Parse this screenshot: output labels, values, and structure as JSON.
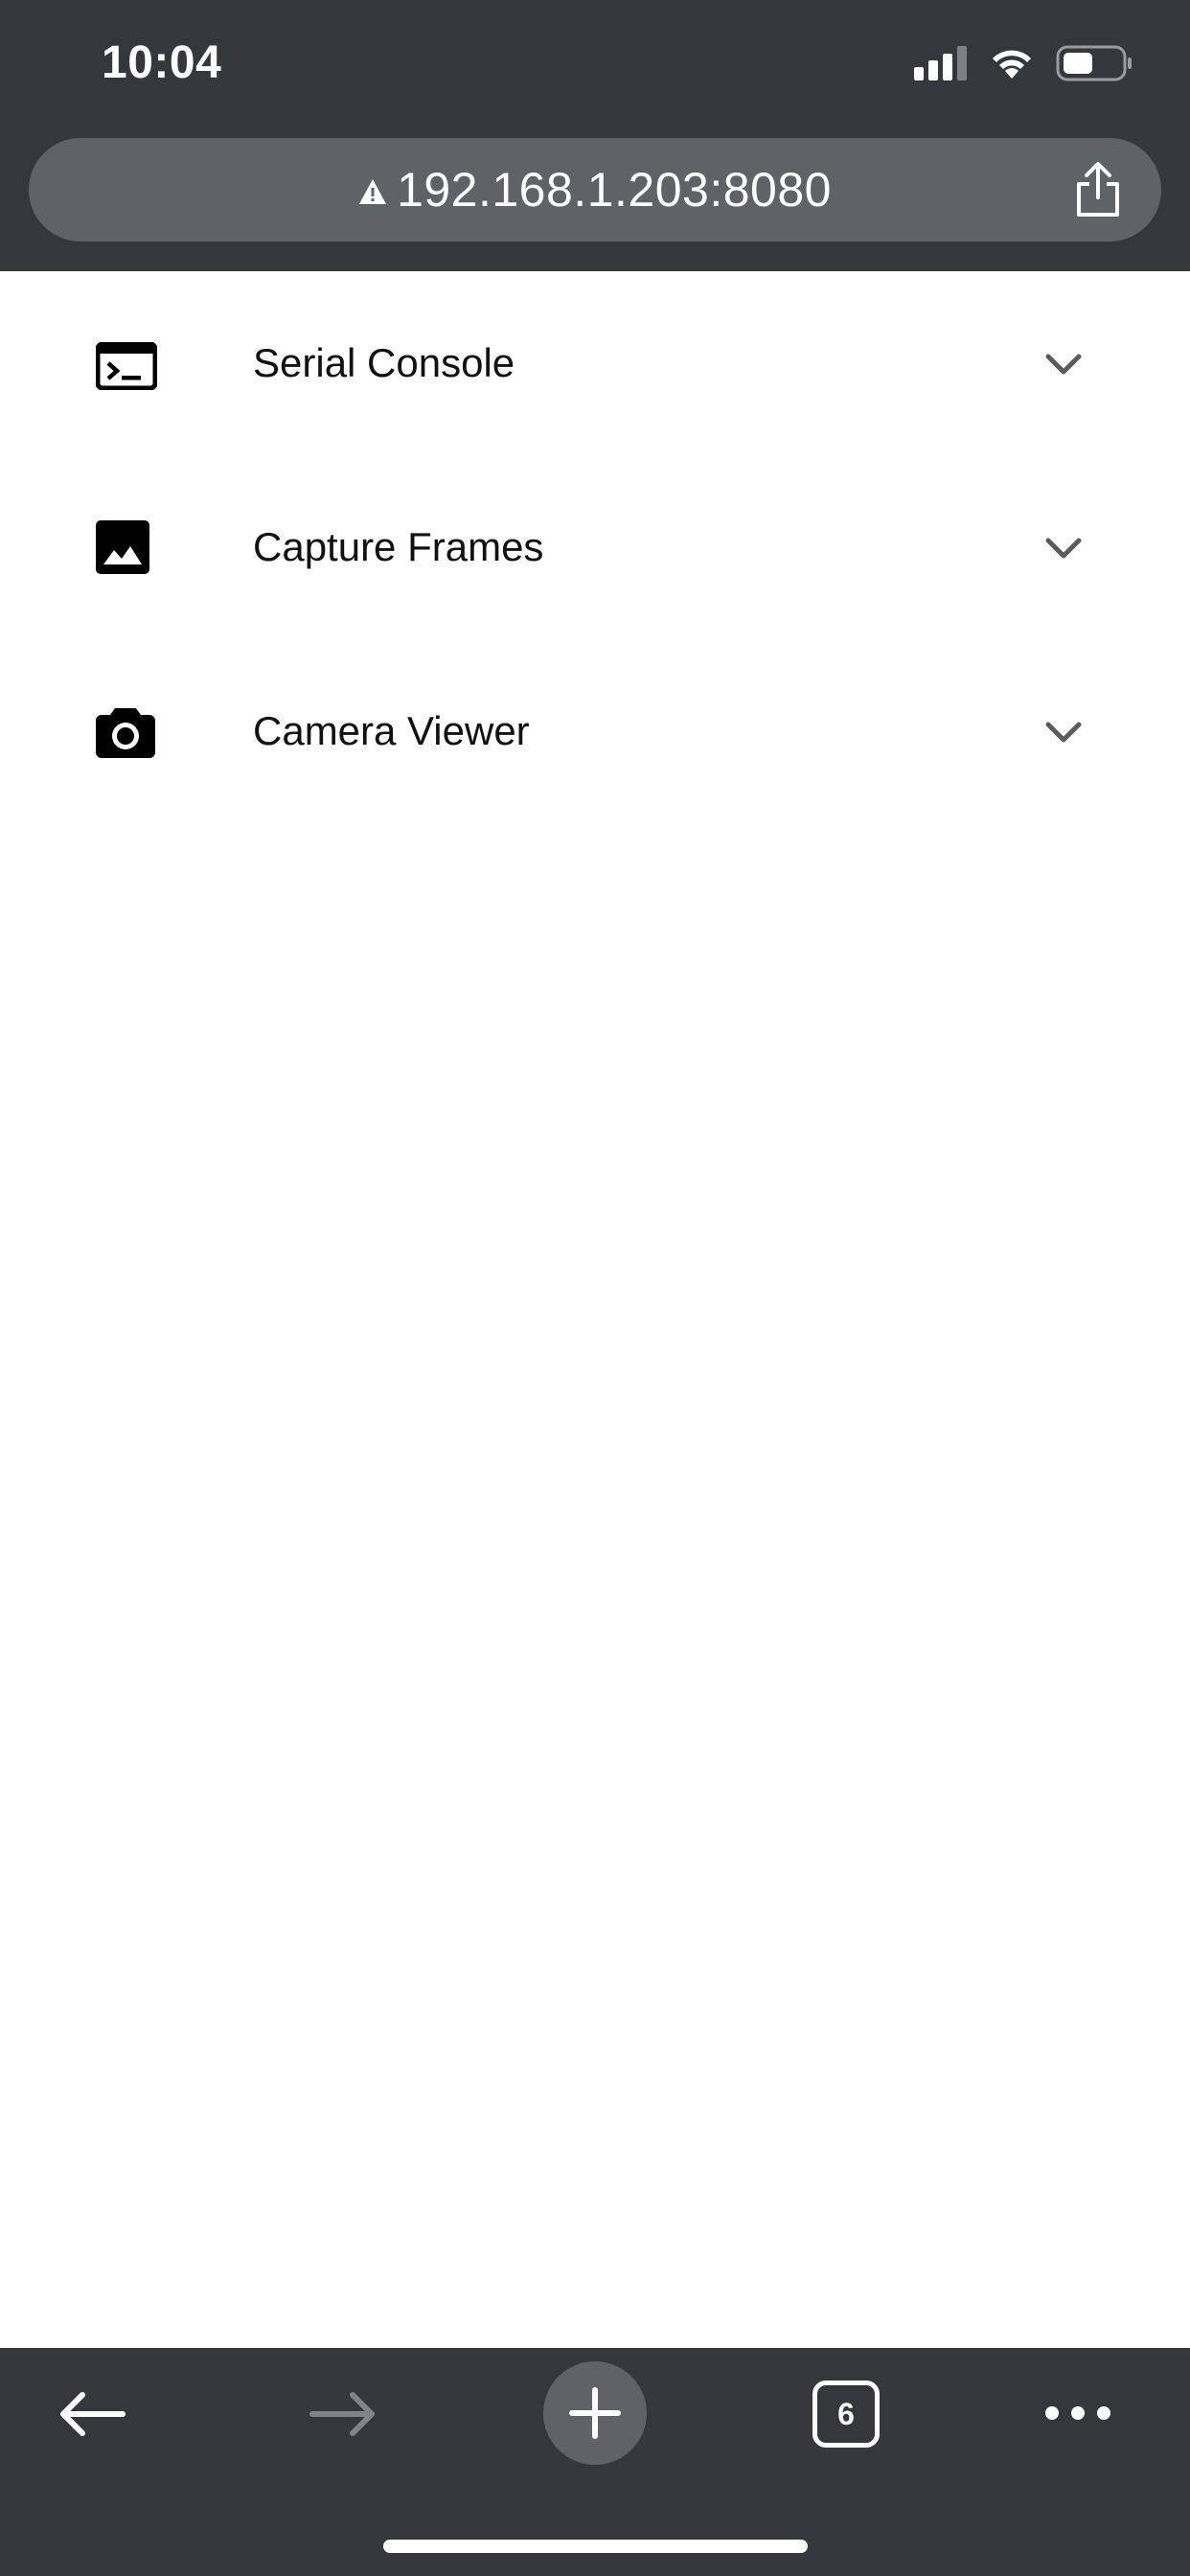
{
  "status_bar": {
    "time": "10:04",
    "icons": [
      "signal-icon",
      "wifi-icon",
      "battery-icon"
    ]
  },
  "browser": {
    "url": "192.168.1.203:8080",
    "security_icon": "warning-icon",
    "share_icon": "share-icon"
  },
  "menu": {
    "items": [
      {
        "label": "Serial Console",
        "icon": "terminal-icon"
      },
      {
        "label": "Capture Frames",
        "icon": "image-icon"
      },
      {
        "label": "Camera Viewer",
        "icon": "camera-icon"
      }
    ]
  },
  "toolbar": {
    "back_icon": "back-arrow-icon",
    "forward_icon": "forward-arrow-icon",
    "new_tab_icon": "plus-icon",
    "tab_count": "6",
    "more_icon": "more-icon"
  },
  "colors": {
    "chrome_background": "#34373b",
    "url_bar_background": "#5f6266",
    "page_background": "#ffffff",
    "forward_disabled": "#808387"
  }
}
